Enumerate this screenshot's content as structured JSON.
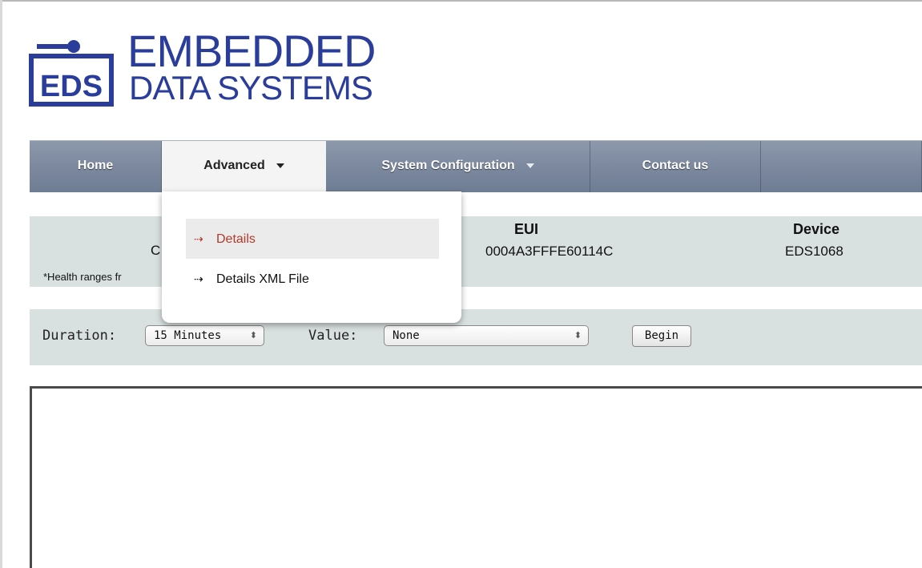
{
  "logo": {
    "badge_text": "EDS",
    "line1": "EMBEDDED",
    "line2": "DATA SYSTEMS",
    "color": "#2a3d9b"
  },
  "nav": {
    "home": "Home",
    "advanced": "Advanced",
    "system_configuration": "System Configuration",
    "contact": "Contact us",
    "active_item": "Advanced",
    "bar_color": "#7d8aa0"
  },
  "dropdown": {
    "items": [
      {
        "label": "Details",
        "arrow_icon": "dashed-arrow-right-icon",
        "highlighted": true,
        "color": "#b13a2a"
      },
      {
        "label": "Details XML File",
        "arrow_icon": "dashed-arrow-right-icon",
        "highlighted": false
      }
    ]
  },
  "info": {
    "partial_text": "C",
    "health_note": "*Health ranges fr",
    "eui_label": "EUI",
    "eui_value": "0004A3FFFE60114C",
    "device_label": "Device",
    "device_value": "EDS1068"
  },
  "controls": {
    "duration_label": "Duration:",
    "duration_value": "15 Minutes",
    "value_label": "Value:",
    "value_value": "None",
    "begin_label": "Begin"
  },
  "colors": {
    "strip_background": "#d9e0e0",
    "highlight_red": "#b13a2a"
  }
}
